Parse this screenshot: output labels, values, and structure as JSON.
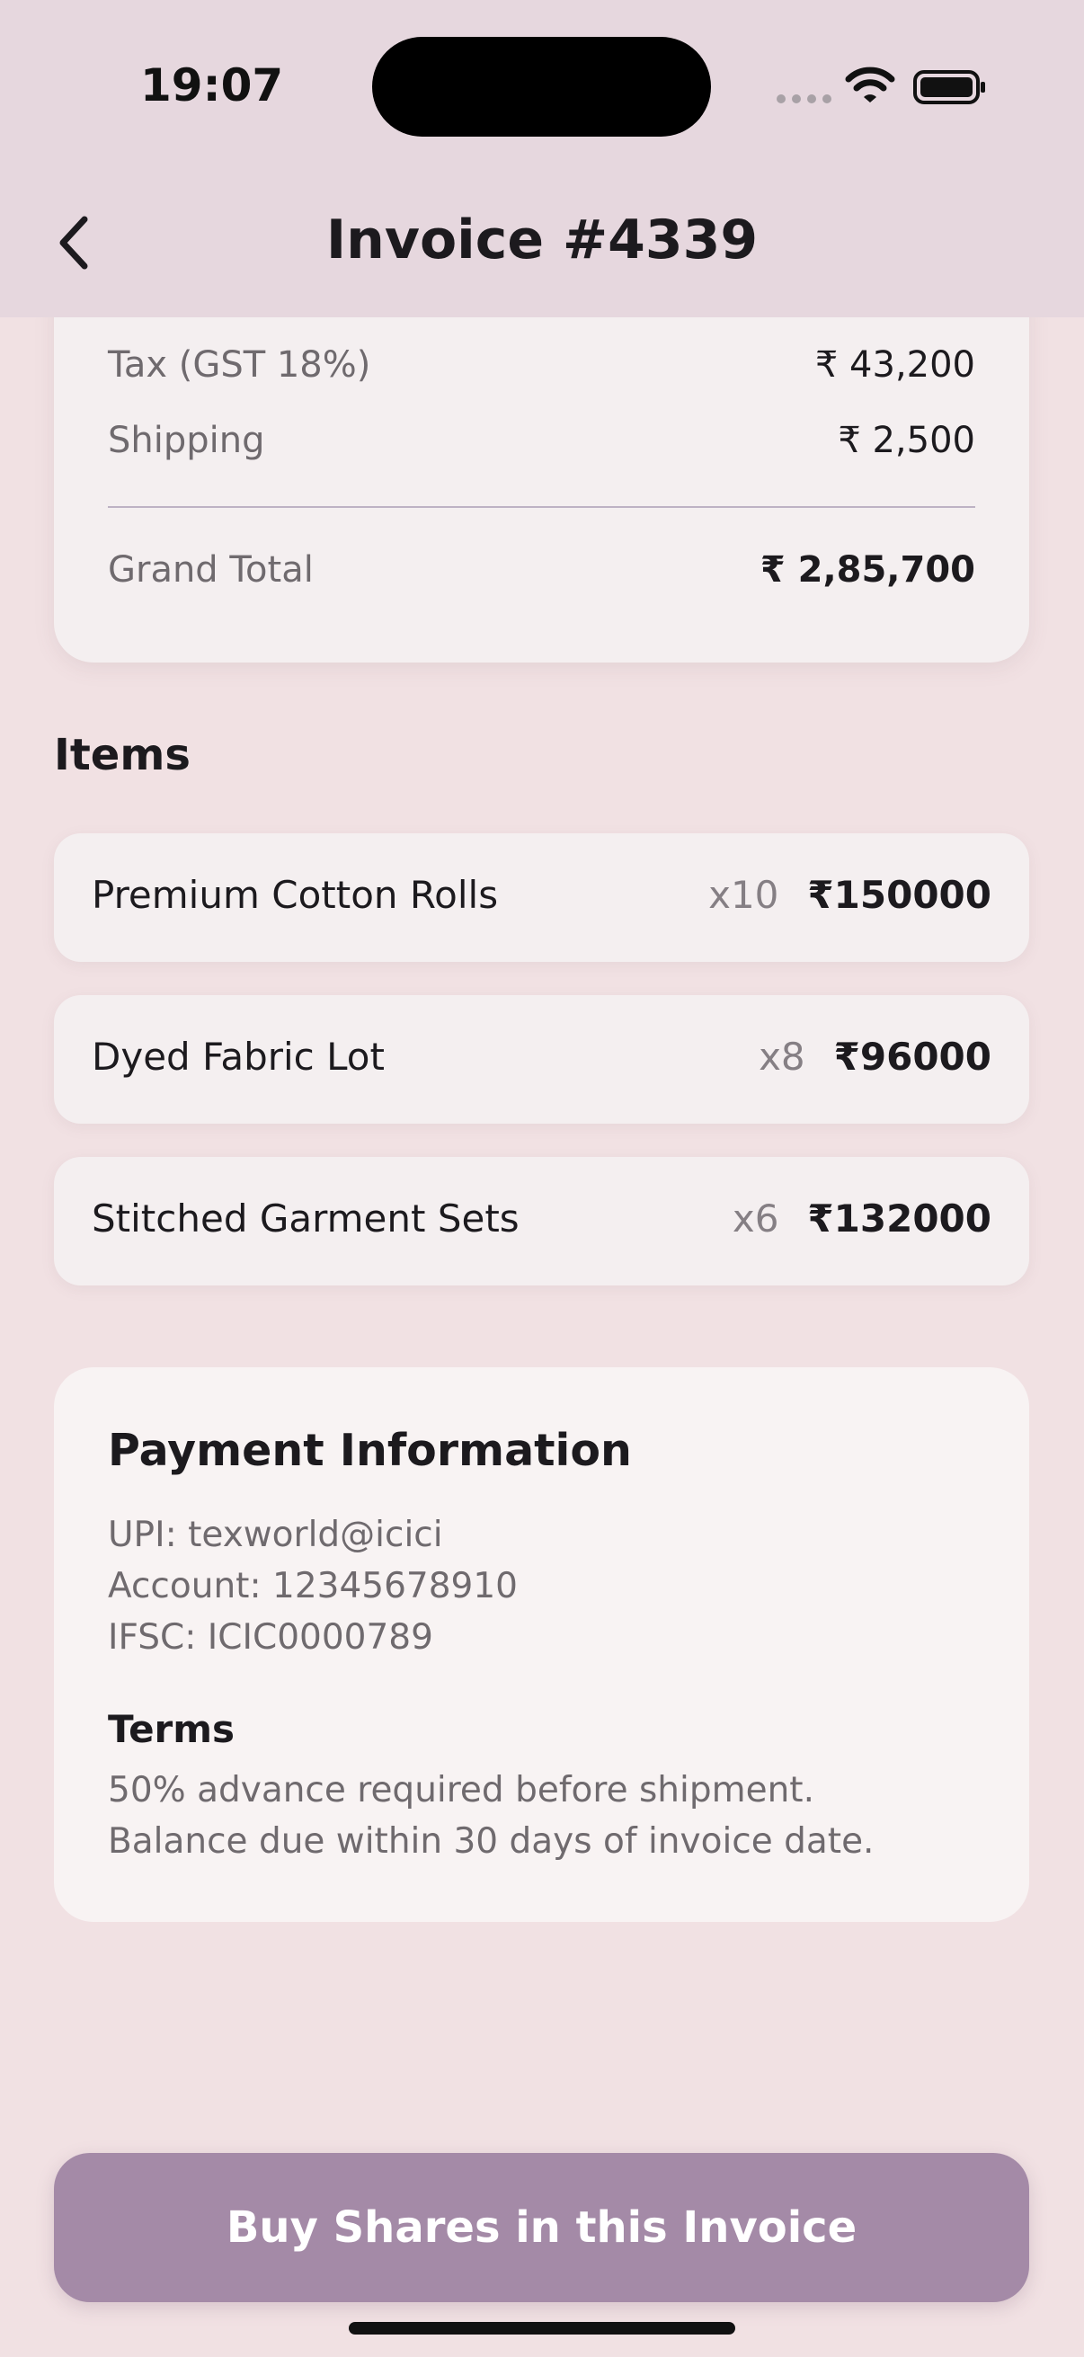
{
  "status_bar": {
    "time": "19:07"
  },
  "header": {
    "title": "Invoice #4339",
    "back_icon": "chevron-left-icon"
  },
  "summary": {
    "rows": [
      {
        "label": "Tax (GST 18%)",
        "value": "₹ 43,200"
      },
      {
        "label": "Shipping",
        "value": "₹ 2,500"
      }
    ],
    "grand_total": {
      "label": "Grand Total",
      "value": "₹ 2,85,700"
    }
  },
  "items_section": {
    "title": "Items",
    "items": [
      {
        "name": "Premium Cotton Rolls",
        "qty": "x10",
        "price": "₹150000"
      },
      {
        "name": "Dyed Fabric Lot",
        "qty": "x8",
        "price": "₹96000"
      },
      {
        "name": "Stitched Garment Sets",
        "qty": "x6",
        "price": "₹132000"
      }
    ]
  },
  "payment": {
    "title": "Payment Information",
    "upi": "UPI: texworld@icici",
    "account": "Account: 12345678910",
    "ifsc": "IFSC: ICIC0000789",
    "terms_title": "Terms",
    "terms_line1": "50% advance required before shipment.",
    "terms_line2": "Balance due within 30 days of invoice date."
  },
  "cta": {
    "label": "Buy Shares in this Invoice"
  },
  "colors": {
    "background": "#f1e1e3",
    "header": "#e6d7de",
    "button": "#a48aa7",
    "card": "#f4eff0"
  }
}
